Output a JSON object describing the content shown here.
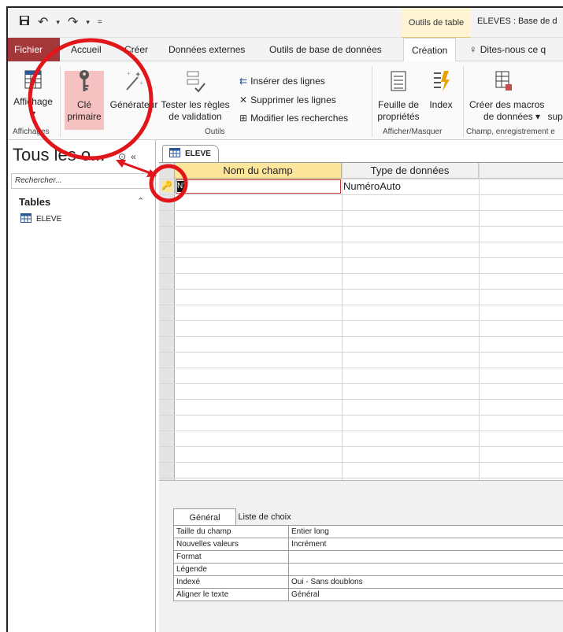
{
  "title_bar": {
    "qat_icons": [
      "save-icon",
      "undo-icon",
      "redo-icon",
      "customize-icon"
    ],
    "context_tab": "Outils de table",
    "window_title": "ELEVES : Base de d"
  },
  "tabs": {
    "file": "Fichier",
    "home": "Accueil",
    "create": "Créer",
    "external": "Données externes",
    "dbtools": "Outils de base de données",
    "design": "Création",
    "tellme": "Dites-nous ce q"
  },
  "ribbon": {
    "view": {
      "label1": "Affichage",
      "label2": "▾"
    },
    "primary_key": {
      "label1": "Clé",
      "label2": "primaire"
    },
    "builder": {
      "label": "Générateur"
    },
    "validation": {
      "label1": "Tester les règles",
      "label2": "de validation"
    },
    "insert_rows": "Insérer des lignes",
    "delete_rows": "Supprimer les lignes",
    "modify_lookups": "Modifier les recherches",
    "property_sheet": {
      "label1": "Feuille de",
      "label2": "propriétés"
    },
    "index": "Index",
    "macros": {
      "label1": "Créer des macros",
      "label2": "de données ▾",
      "label3": "sup"
    },
    "groups": {
      "views": "Affichages",
      "tools": "Outils",
      "show_hide": "Afficher/Masquer",
      "events": "Champ, enregistrement e"
    }
  },
  "nav": {
    "title": "Tous les o...",
    "search_placeholder": "Rechercher...",
    "section": "Tables",
    "items": [
      {
        "label": "ELEVE"
      }
    ]
  },
  "doc": {
    "tab_label": "ELEVE",
    "columns": {
      "field": "Nom du champ",
      "type": "Type de données"
    },
    "rows": [
      {
        "field": "N°",
        "type": "NuméroAuto",
        "primary_key": true
      }
    ]
  },
  "props": {
    "tab_general": "Général",
    "tab_lookup": "Liste de choix",
    "rows": [
      {
        "key": "Taille du champ",
        "value": "Entier long"
      },
      {
        "key": "Nouvelles valeurs",
        "value": "Incrément"
      },
      {
        "key": "Format",
        "value": ""
      },
      {
        "key": "Légende",
        "value": ""
      },
      {
        "key": "Indexé",
        "value": "Oui - Sans doublons"
      },
      {
        "key": "Aligner le texte",
        "value": "Général"
      }
    ]
  },
  "colors": {
    "file_tab": "#a4373a",
    "field_header": "#fde69b",
    "annotation": "#e0161b",
    "selected_button": "#f5c1c1"
  }
}
